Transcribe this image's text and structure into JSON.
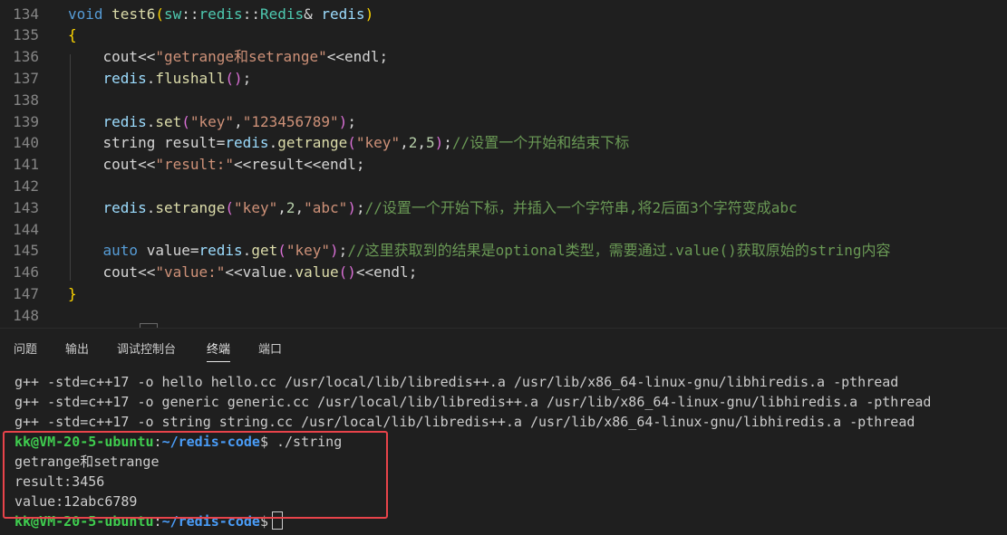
{
  "editor": {
    "lines": [
      {
        "num": "134",
        "tokens": [
          {
            "t": "void",
            "c": "kw"
          },
          {
            "t": " ",
            "c": "plain"
          },
          {
            "t": "test6",
            "c": "fn"
          },
          {
            "t": "(",
            "c": "brk1"
          },
          {
            "t": "sw",
            "c": "ns"
          },
          {
            "t": "::",
            "c": "plain"
          },
          {
            "t": "redis",
            "c": "ns"
          },
          {
            "t": "::",
            "c": "plain"
          },
          {
            "t": "Redis",
            "c": "ns"
          },
          {
            "t": "& ",
            "c": "plain"
          },
          {
            "t": "redis",
            "c": "var"
          },
          {
            "t": ")",
            "c": "brk1"
          }
        ]
      },
      {
        "num": "135",
        "tokens": [
          {
            "t": "{",
            "c": "brk1"
          }
        ]
      },
      {
        "num": "136",
        "tokens": [
          {
            "t": "    cout<<",
            "c": "plain"
          },
          {
            "t": "\"getrange和setrange\"",
            "c": "str"
          },
          {
            "t": "<<endl;",
            "c": "plain"
          }
        ]
      },
      {
        "num": "137",
        "tokens": [
          {
            "t": "    ",
            "c": "plain"
          },
          {
            "t": "redis",
            "c": "var"
          },
          {
            "t": ".",
            "c": "plain"
          },
          {
            "t": "flushall",
            "c": "fn"
          },
          {
            "t": "()",
            "c": "brk2"
          },
          {
            "t": ";",
            "c": "plain"
          }
        ]
      },
      {
        "num": "138",
        "tokens": []
      },
      {
        "num": "139",
        "tokens": [
          {
            "t": "    ",
            "c": "plain"
          },
          {
            "t": "redis",
            "c": "var"
          },
          {
            "t": ".",
            "c": "plain"
          },
          {
            "t": "set",
            "c": "fn"
          },
          {
            "t": "(",
            "c": "brk2"
          },
          {
            "t": "\"key\"",
            "c": "str"
          },
          {
            "t": ",",
            "c": "plain"
          },
          {
            "t": "\"123456789\"",
            "c": "str"
          },
          {
            "t": ")",
            "c": "brk2"
          },
          {
            "t": ";",
            "c": "plain"
          }
        ]
      },
      {
        "num": "140",
        "tokens": [
          {
            "t": "    string result=",
            "c": "plain"
          },
          {
            "t": "redis",
            "c": "var"
          },
          {
            "t": ".",
            "c": "plain"
          },
          {
            "t": "getrange",
            "c": "fn"
          },
          {
            "t": "(",
            "c": "brk2"
          },
          {
            "t": "\"key\"",
            "c": "str"
          },
          {
            "t": ",",
            "c": "plain"
          },
          {
            "t": "2",
            "c": "num"
          },
          {
            "t": ",",
            "c": "plain"
          },
          {
            "t": "5",
            "c": "num"
          },
          {
            "t": ")",
            "c": "brk2"
          },
          {
            "t": ";",
            "c": "plain"
          },
          {
            "t": "//设置一个开始和结束下标",
            "c": "cmt"
          }
        ]
      },
      {
        "num": "141",
        "tokens": [
          {
            "t": "    cout<<",
            "c": "plain"
          },
          {
            "t": "\"result:\"",
            "c": "str"
          },
          {
            "t": "<<result<<endl;",
            "c": "plain"
          }
        ]
      },
      {
        "num": "142",
        "tokens": []
      },
      {
        "num": "143",
        "tokens": [
          {
            "t": "    ",
            "c": "plain"
          },
          {
            "t": "redis",
            "c": "var"
          },
          {
            "t": ".",
            "c": "plain"
          },
          {
            "t": "setrange",
            "c": "fn"
          },
          {
            "t": "(",
            "c": "brk2"
          },
          {
            "t": "\"key\"",
            "c": "str"
          },
          {
            "t": ",",
            "c": "plain"
          },
          {
            "t": "2",
            "c": "num"
          },
          {
            "t": ",",
            "c": "plain"
          },
          {
            "t": "\"abc\"",
            "c": "str"
          },
          {
            "t": ")",
            "c": "brk2"
          },
          {
            "t": ";",
            "c": "plain"
          },
          {
            "t": "//设置一个开始下标，并插入一个字符串,将2后面3个字符变成abc",
            "c": "cmt"
          }
        ]
      },
      {
        "num": "144",
        "tokens": []
      },
      {
        "num": "145",
        "tokens": [
          {
            "t": "    ",
            "c": "plain"
          },
          {
            "t": "auto",
            "c": "kw"
          },
          {
            "t": " value=",
            "c": "plain"
          },
          {
            "t": "redis",
            "c": "var"
          },
          {
            "t": ".",
            "c": "plain"
          },
          {
            "t": "get",
            "c": "fn"
          },
          {
            "t": "(",
            "c": "brk2"
          },
          {
            "t": "\"key\"",
            "c": "str"
          },
          {
            "t": ")",
            "c": "brk2"
          },
          {
            "t": ";",
            "c": "plain"
          },
          {
            "t": "//这里获取到的结果是optional类型，需要通过.value()获取原始的string内容",
            "c": "cmt"
          }
        ]
      },
      {
        "num": "146",
        "tokens": [
          {
            "t": "    cout<<",
            "c": "plain"
          },
          {
            "t": "\"value:\"",
            "c": "str"
          },
          {
            "t": "<<value.",
            "c": "plain"
          },
          {
            "t": "value",
            "c": "fn"
          },
          {
            "t": "()",
            "c": "brk2"
          },
          {
            "t": "<<endl;",
            "c": "plain"
          }
        ]
      },
      {
        "num": "147",
        "tokens": [
          {
            "t": "}",
            "c": "brk1"
          }
        ]
      },
      {
        "num": "148",
        "tokens": []
      }
    ]
  },
  "panel": {
    "tabs": [
      {
        "label": "问题",
        "active": false
      },
      {
        "label": "输出",
        "active": false
      },
      {
        "label": "调试控制台",
        "active": false
      },
      {
        "label": "终端",
        "active": true
      },
      {
        "label": "端口",
        "active": false
      }
    ]
  },
  "terminal": {
    "build_lines": [
      "g++ -std=c++17 -o hello hello.cc /usr/local/lib/libredis++.a /usr/lib/x86_64-linux-gnu/libhiredis.a -pthread",
      "g++ -std=c++17 -o generic generic.cc /usr/local/lib/libredis++.a /usr/lib/x86_64-linux-gnu/libhiredis.a -pthread",
      "g++ -std=c++17 -o string string.cc /usr/local/lib/libredis++.a /usr/lib/x86_64-linux-gnu/libhiredis.a -pthread"
    ],
    "prompt_user": "kk@VM-20-5-ubuntu",
    "prompt_sep": ":",
    "prompt_path": "~/redis-code",
    "prompt_symbol": "$",
    "command": " ./string",
    "output": [
      "getrange和setrange",
      "result:3456",
      "value:12abc6789"
    ]
  },
  "colors": {
    "highlight_box": "#e8434a",
    "prompt_user": "#3fcd4f",
    "prompt_path": "#4a9df8"
  }
}
